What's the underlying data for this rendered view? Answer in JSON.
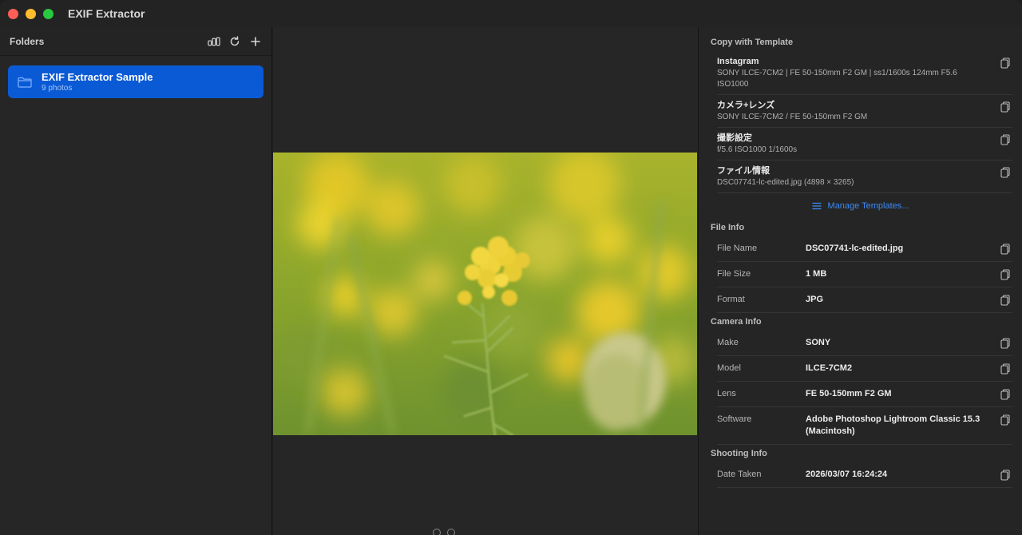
{
  "app": {
    "title": "EXIF Extractor"
  },
  "sidebar": {
    "title": "Folders",
    "folders": [
      {
        "name": "EXIF Extractor Sample",
        "count": "9 photos"
      }
    ]
  },
  "templates": {
    "title": "Copy with Template",
    "items": [
      {
        "name": "Instagram",
        "value": "SONY ILCE-7CM2 | FE 50-150mm F2 GM | ss1/1600s 124mm F5.6 ISO1000"
      },
      {
        "name": "カメラ+レンズ",
        "value": "SONY ILCE-7CM2 / FE 50-150mm F2 GM"
      },
      {
        "name": "撮影設定",
        "value": "f/5.6 ISO1000 1/1600s"
      },
      {
        "name": "ファイル情報",
        "value": "DSC07741-lc-edited.jpg (4898 × 3265)"
      }
    ],
    "manage_label": "Manage Templates..."
  },
  "file_info": {
    "title": "File Info",
    "rows": [
      {
        "label": "File Name",
        "value": "DSC07741-lc-edited.jpg"
      },
      {
        "label": "File Size",
        "value": "1 MB"
      },
      {
        "label": "Format",
        "value": "JPG"
      }
    ]
  },
  "camera_info": {
    "title": "Camera Info",
    "rows": [
      {
        "label": "Make",
        "value": "SONY"
      },
      {
        "label": "Model",
        "value": "ILCE-7CM2"
      },
      {
        "label": "Lens",
        "value": "FE 50-150mm F2 GM"
      },
      {
        "label": "Software",
        "value": "Adobe Photoshop Lightroom Classic 15.3 (Macintosh)"
      }
    ]
  },
  "shooting_info": {
    "title": "Shooting Info",
    "rows": [
      {
        "label": "Date Taken",
        "value": "2026/03/07 16:24:24"
      }
    ]
  },
  "colors": {
    "accent": "#0a5ad6",
    "link": "#3d8bf5"
  }
}
